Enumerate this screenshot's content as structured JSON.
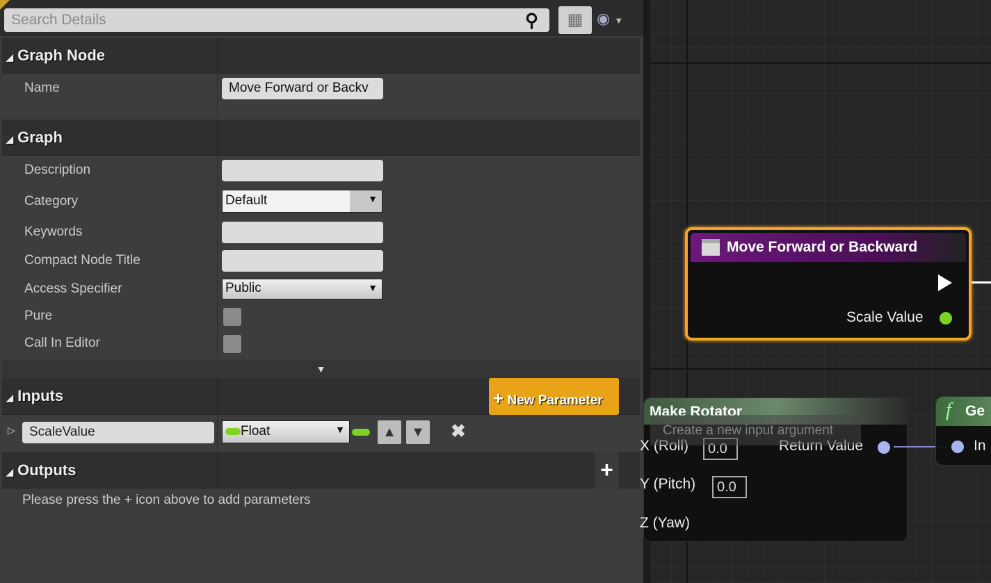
{
  "search": {
    "placeholder": "Search Details"
  },
  "toolbar": {
    "grid_icon": "property-matrix-icon",
    "view_icon": "eye-icon"
  },
  "graph_node": {
    "header": "Graph Node",
    "name_label": "Name",
    "name_value": "Move Forward or Backv"
  },
  "graph": {
    "header": "Graph",
    "rows": [
      {
        "label": "Description",
        "value": ""
      },
      {
        "label": "Category",
        "value": "Default"
      },
      {
        "label": "Keywords",
        "value": ""
      },
      {
        "label": "Compact Node Title",
        "value": ""
      },
      {
        "label": "Access Specifier",
        "value": "Public"
      },
      {
        "label": "Pure",
        "checked": false
      },
      {
        "label": "Call In Editor",
        "checked": false
      }
    ]
  },
  "inputs": {
    "header": "Inputs",
    "new_param": "New Parameter",
    "param": {
      "name": "ScaleValue",
      "type": "Float",
      "type_color": "#7ed321"
    }
  },
  "outputs": {
    "header": "Outputs",
    "message": "Please press the + icon above to add parameters"
  },
  "tooltip": "Create a new input argument",
  "canvas": {
    "event_node": {
      "title": "Move Forward or Backward",
      "pin": "Scale Value",
      "header_color": "#6a1a7a",
      "selected_color": "#f5a623"
    },
    "rotator_node": {
      "title": "Make Rotator",
      "pins": [
        {
          "label": "X (Roll)",
          "value": "0.0"
        },
        {
          "label": "Y (Pitch)",
          "value": "0.0"
        },
        {
          "label": "Z (Yaw)"
        }
      ],
      "output": "Return Value"
    },
    "func_node": {
      "title": "Ge",
      "pin": "In"
    }
  }
}
